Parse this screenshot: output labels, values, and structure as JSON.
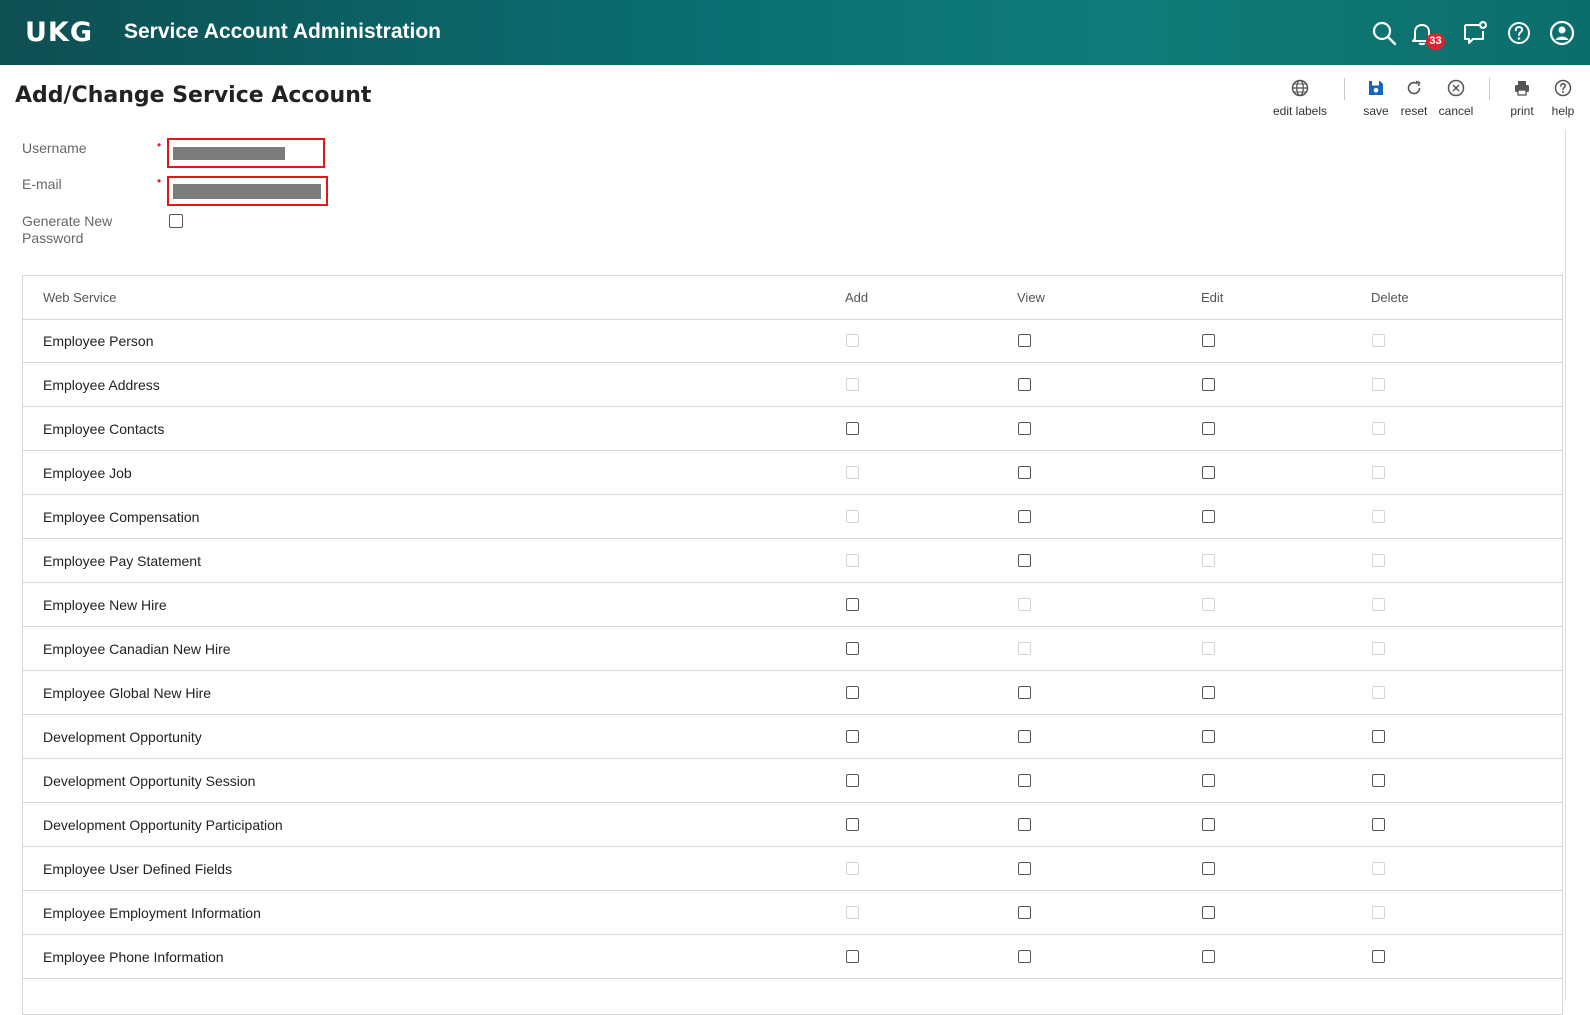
{
  "app": {
    "logo": "UKG",
    "title": "Service Account Administration",
    "notification_count": "33",
    "icons": [
      "search-icon",
      "bell-icon",
      "chat-plus-icon",
      "help-circle-icon",
      "user-icon"
    ]
  },
  "page": {
    "title": "Add/Change Service Account"
  },
  "toolbar": {
    "edit_labels": "edit labels",
    "save": "save",
    "reset": "reset",
    "cancel": "cancel",
    "print": "print",
    "help": "help"
  },
  "form": {
    "username_label": "Username",
    "email_label": "E-mail",
    "generate_password_label_1": "Generate New",
    "generate_password_label_2": "Password",
    "required_mark": "•",
    "generate_password_checked": false
  },
  "grid": {
    "headers": [
      "Web Service",
      "Add",
      "View",
      "Edit",
      "Delete"
    ],
    "rows": [
      {
        "name": "Employee Person",
        "add": "disabled",
        "view": "enabled",
        "edit": "enabled",
        "delete": "disabled"
      },
      {
        "name": "Employee Address",
        "add": "disabled",
        "view": "enabled",
        "edit": "enabled",
        "delete": "disabled"
      },
      {
        "name": "Employee Contacts",
        "add": "enabled",
        "view": "enabled",
        "edit": "enabled",
        "delete": "disabled"
      },
      {
        "name": "Employee Job",
        "add": "disabled",
        "view": "enabled",
        "edit": "enabled",
        "delete": "disabled"
      },
      {
        "name": "Employee Compensation",
        "add": "disabled",
        "view": "enabled",
        "edit": "enabled",
        "delete": "disabled"
      },
      {
        "name": "Employee Pay Statement",
        "add": "disabled",
        "view": "enabled",
        "edit": "disabled",
        "delete": "disabled"
      },
      {
        "name": "Employee New Hire",
        "add": "enabled",
        "view": "disabled",
        "edit": "disabled",
        "delete": "disabled"
      },
      {
        "name": "Employee Canadian New Hire",
        "add": "enabled",
        "view": "disabled",
        "edit": "disabled",
        "delete": "disabled"
      },
      {
        "name": "Employee Global New Hire",
        "add": "enabled",
        "view": "enabled",
        "edit": "enabled",
        "delete": "disabled"
      },
      {
        "name": "Development Opportunity",
        "add": "enabled",
        "view": "enabled",
        "edit": "enabled",
        "delete": "enabled"
      },
      {
        "name": "Development Opportunity Session",
        "add": "enabled",
        "view": "enabled",
        "edit": "enabled",
        "delete": "enabled"
      },
      {
        "name": "Development Opportunity Participation",
        "add": "enabled",
        "view": "enabled",
        "edit": "enabled",
        "delete": "enabled"
      },
      {
        "name": "Employee User Defined Fields",
        "add": "disabled",
        "view": "enabled",
        "edit": "enabled",
        "delete": "disabled"
      },
      {
        "name": "Employee Employment Information",
        "add": "disabled",
        "view": "enabled",
        "edit": "enabled",
        "delete": "disabled"
      },
      {
        "name": "Employee Phone Information",
        "add": "enabled",
        "view": "enabled",
        "edit": "enabled",
        "delete": "enabled"
      }
    ]
  },
  "colors": {
    "header_teal": "#0a6f72",
    "required_red": "#d6272f",
    "field_border": "#e3161c",
    "save_blue": "#1565c0"
  }
}
